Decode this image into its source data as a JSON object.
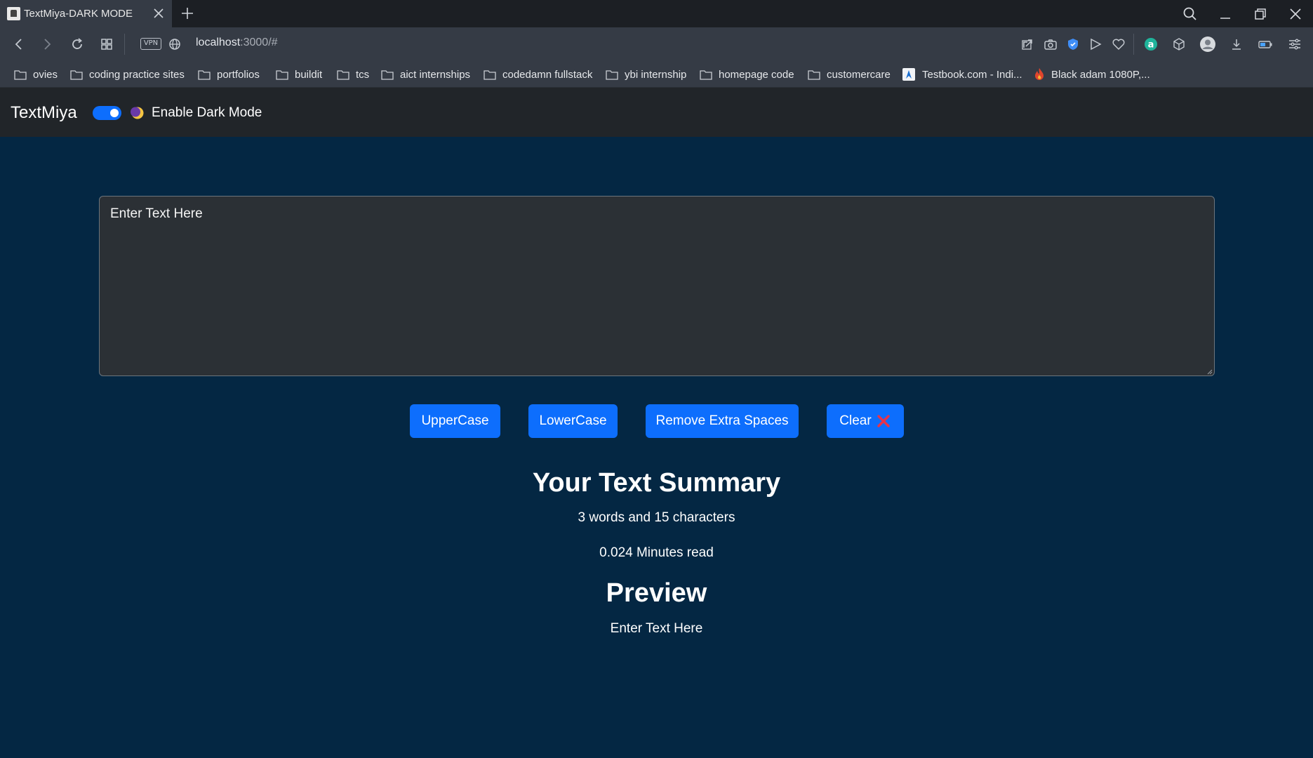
{
  "browser": {
    "tab_title": "TextMiya-DARK MODE",
    "url_host": "localhost",
    "url_path": ":3000/#",
    "vpn_label": "VPN",
    "bookmarks": [
      {
        "label": "ovies",
        "icon": "folder-icon"
      },
      {
        "label": "coding practice sites",
        "icon": "folder-icon"
      },
      {
        "label": "portfolios",
        "icon": "folder-icon"
      },
      {
        "label": "buildit",
        "icon": "folder-icon"
      },
      {
        "label": "tcs",
        "icon": "folder-icon"
      },
      {
        "label": "aict internships",
        "icon": "folder-icon"
      },
      {
        "label": "codedamn fullstack",
        "icon": "folder-icon"
      },
      {
        "label": "ybi internship",
        "icon": "folder-icon"
      },
      {
        "label": "homepage code",
        "icon": "folder-icon"
      },
      {
        "label": "customercare",
        "icon": "folder-icon"
      },
      {
        "label": "Testbook.com - Indi...",
        "icon": "testbook-favicon"
      },
      {
        "label": "Black adam 1080P,...",
        "icon": "flame-favicon"
      }
    ]
  },
  "app": {
    "brand": "TextMiya",
    "dark_mode_label": "Enable Dark Mode",
    "dark_mode_on": true,
    "textarea_value": "Enter Text Here",
    "buttons": {
      "uppercase": "UpperCase",
      "lowercase": "LowerCase",
      "remove_spaces": "Remove Extra Spaces",
      "clear": "Clear"
    },
    "summary_heading": "Your Text Summary",
    "word_char_count": "3 words and 15 characters",
    "read_time": "0.024 Minutes read",
    "preview_heading": "Preview",
    "preview_text": "Enter Text Here"
  },
  "colors": {
    "page_bg": "#042743",
    "navbar_bg": "#212529",
    "button_primary": "#0d6efd",
    "textarea_bg": "#2b3035",
    "clear_icon": "#e8334a"
  }
}
